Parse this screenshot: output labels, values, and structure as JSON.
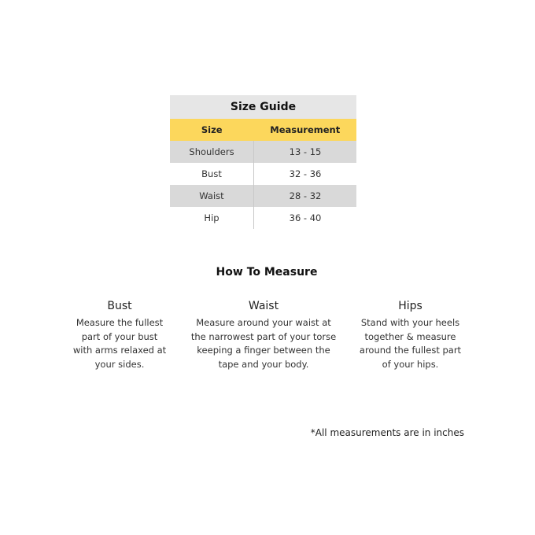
{
  "size_guide": {
    "title": "Size Guide",
    "headers": {
      "size": "Size",
      "measurement": "Measurement"
    },
    "rows": [
      {
        "size": "Shoulders",
        "measurement": "13 - 15"
      },
      {
        "size": "Bust",
        "measurement": "32 - 36"
      },
      {
        "size": "Waist",
        "measurement": "28 - 32"
      },
      {
        "size": "Hip",
        "measurement": "36 - 40"
      }
    ],
    "colors": {
      "title_bg": "#e6e6e6",
      "header_bg": "#fcd75c",
      "shaded_row_bg": "#d9d9d9"
    }
  },
  "how_to_measure": {
    "title": "How To Measure",
    "items": [
      {
        "heading": "Bust",
        "text": "Measure the fullest part of your bust with arms relaxed at your sides."
      },
      {
        "heading": "Waist",
        "text": "Measure around your waist at the narrowest part of your torse keeping a finger between the tape and your body."
      },
      {
        "heading": "Hips",
        "text": "Stand with your heels together & measure around the fullest part of your hips."
      }
    ]
  },
  "footnote": "*All measurements are in inches"
}
